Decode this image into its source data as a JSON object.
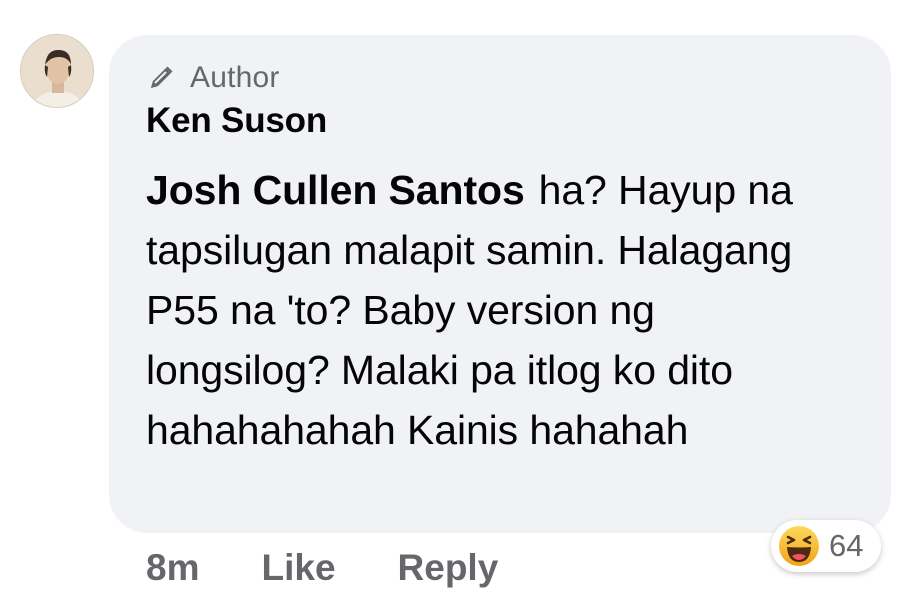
{
  "comment": {
    "badge_label": "Author",
    "commenter_name": "Ken Suson",
    "mention_name": "Josh Cullen Santos",
    "body_text": "ha? Hayup na tapsilugan malapit samin. Halagang P55 na 'to? Baby version ng longsilog? Malaki pa itlog ko dito hahahahahah Kainis hahahah",
    "badge_icon": "pencil-icon",
    "avatar": "avatar"
  },
  "actions": {
    "time": "8m",
    "like_label": "Like",
    "reply_label": "Reply"
  },
  "reactions": {
    "icon": "haha-icon",
    "count": "64"
  },
  "colors": {
    "bubble_bg": "#f0f2f5",
    "secondary_text": "#65676b",
    "primary_text": "#050505",
    "haha_yellow": "#f7b125"
  }
}
